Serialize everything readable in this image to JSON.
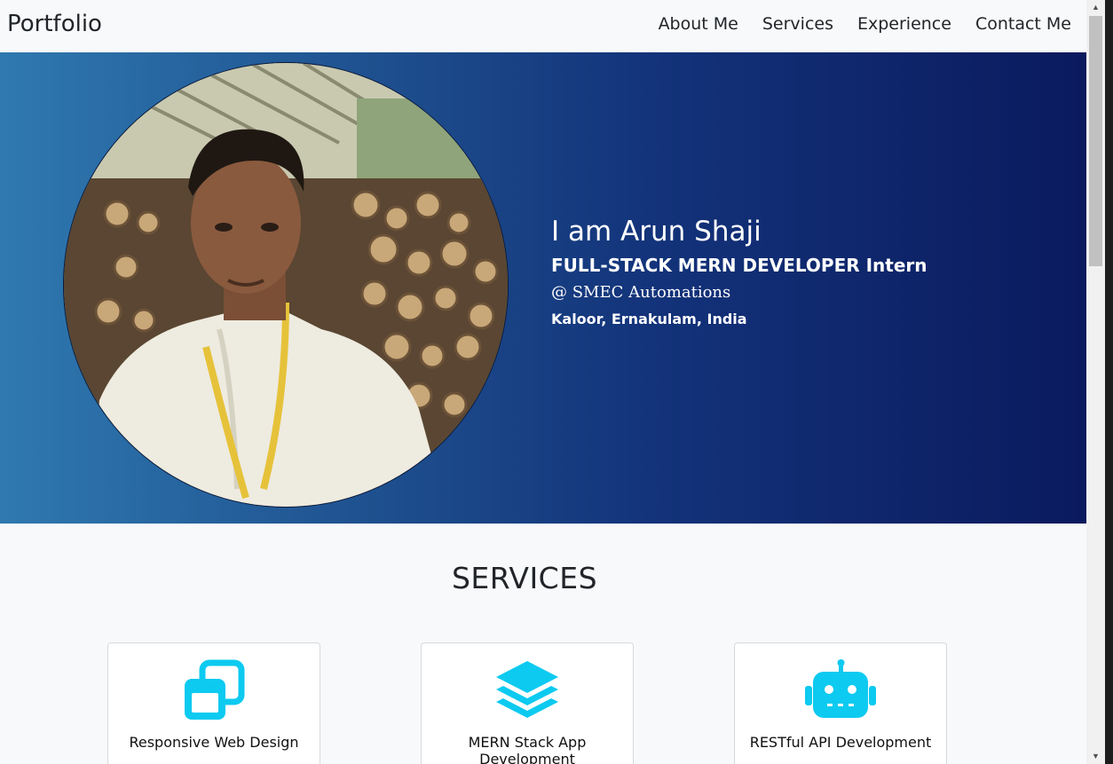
{
  "navbar": {
    "brand": "Portfolio",
    "links": [
      "About Me",
      "Services",
      "Experience",
      "Contact Me"
    ]
  },
  "hero": {
    "name": "I am Arun Shaji",
    "role": "FULL-STACK MERN DEVELOPER Intern",
    "company": "@ SMEC Automations",
    "location": "Kaloor, Ernakulam, India",
    "avatar_icon": "profile-photo"
  },
  "services": {
    "title": "SERVICES",
    "accent_color": "#0dcaf0",
    "items": [
      {
        "label": "Responsive Web Design",
        "icon": "windows-stack-icon"
      },
      {
        "label": "MERN Stack App Development",
        "icon": "layers-icon"
      },
      {
        "label": "RESTful API Development",
        "icon": "robot-icon"
      }
    ]
  },
  "colors": {
    "hero_gradient_start": "#2f79b0",
    "hero_gradient_end": "#0b1a5e",
    "navbar_bg": "#f8f9fa"
  }
}
